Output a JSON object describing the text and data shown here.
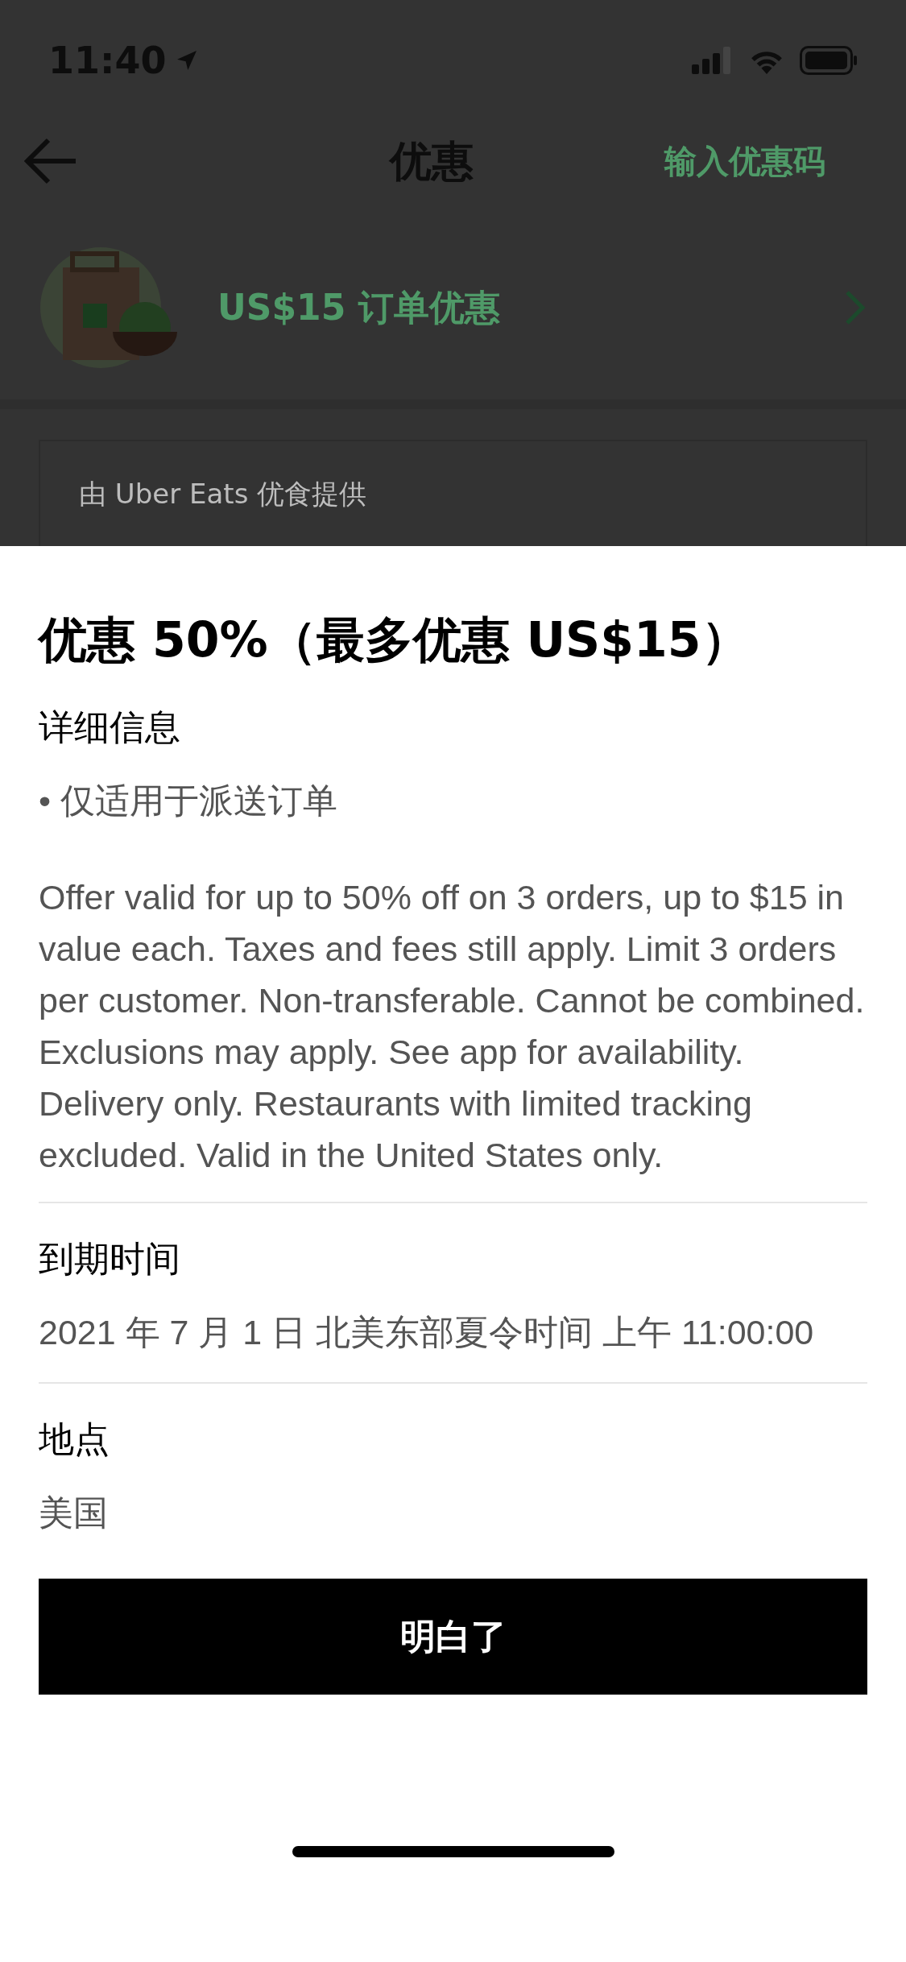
{
  "status_bar": {
    "time": "11:40"
  },
  "nav": {
    "title": "优惠",
    "action": "输入优惠码"
  },
  "offer_row": {
    "label": "US$15 订单优惠"
  },
  "offer_card": {
    "provider": "由 Uber Eats 优食提供"
  },
  "sheet": {
    "title": "优惠 50%（最多优惠 US$15）",
    "sections": [
      {
        "heading": "详细信息",
        "lines": [
          "• 仅适用于派送订单",
          "Offer valid for up to 50% off on 3 orders, up to $15 in value each. Taxes and fees still apply. Limit 3 orders per customer. Non-transferable. Cannot be combined. Exclusions may apply. See app for availability. Delivery only. Restaurants with limited tracking excluded. Valid in the United States only."
        ]
      },
      {
        "heading": "到期时间",
        "lines": [
          "2021 年 7 月 1 日 北美东部夏令时间 上午 11:00:00"
        ]
      },
      {
        "heading": "地点",
        "lines": [
          "美国"
        ]
      }
    ],
    "button": "明白了"
  }
}
